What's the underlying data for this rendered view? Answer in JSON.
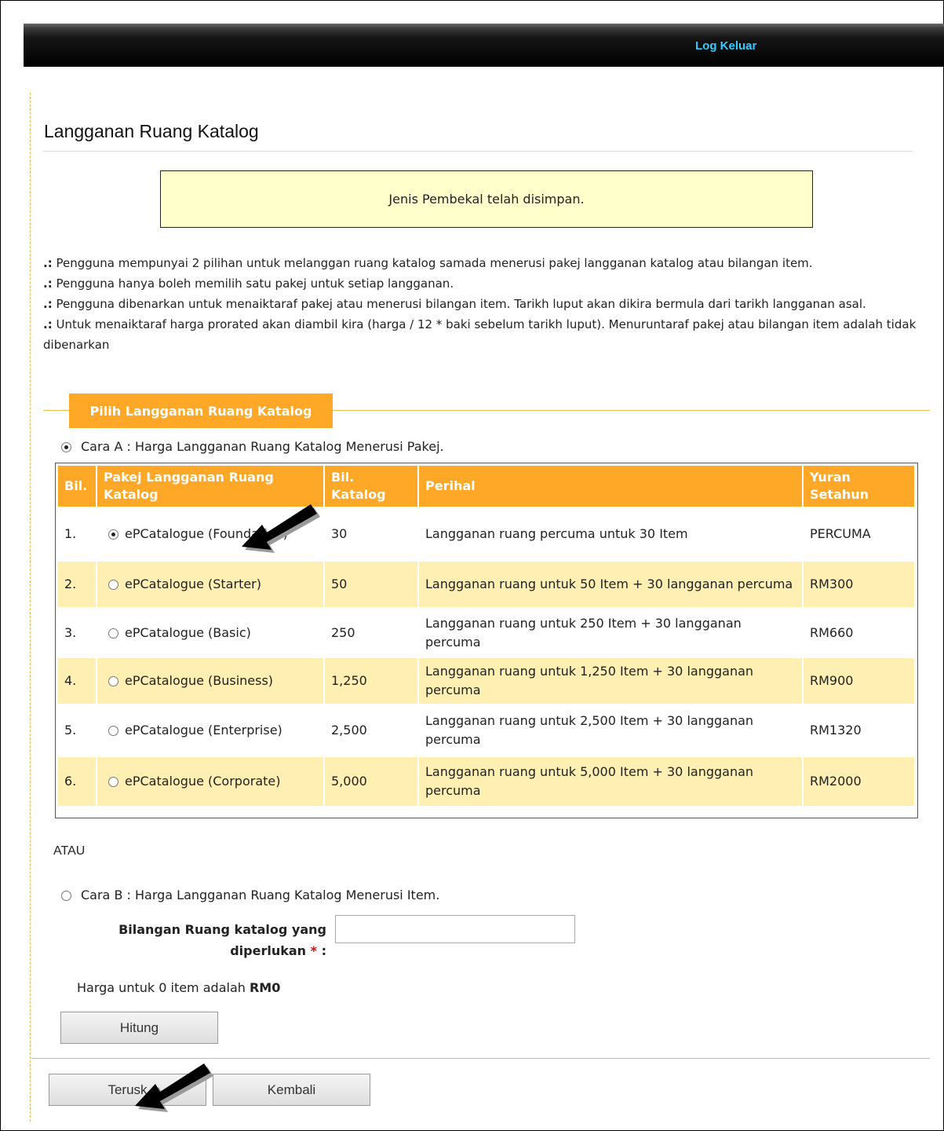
{
  "header": {
    "logout_label": "Log Keluar"
  },
  "page": {
    "title": "Langganan Ruang Katalog"
  },
  "notice": {
    "message": "Jenis Pembekal telah disimpan."
  },
  "notes": {
    "bullet": ".:",
    "items": [
      "Pengguna mempunyai 2 pilihan untuk melanggan ruang katalog samada menerusi pakej langganan katalog atau bilangan item.",
      "Pengguna hanya boleh memilih satu pakej untuk setiap langganan.",
      "Pengguna dibenarkan untuk menaiktaraf pakej atau menerusi bilangan item. Tarikh luput akan dikira bermula dari tarikh langganan asal.",
      "Untuk menaiktaraf harga prorated akan diambil kira (harga / 12 * baki sebelum tarikh luput). Menuruntaraf pakej atau bilangan item adalah tidak dibenarkan"
    ]
  },
  "section": {
    "legend": "Pilih Langganan Ruang Katalog"
  },
  "option_a": {
    "label": "Cara A : Harga Langganan Ruang Katalog Menerusi Pakej.",
    "selected": true
  },
  "table": {
    "headers": [
      "Bil.",
      "Pakej Langganan Ruang Katalog",
      "Bil. Katalog",
      "Perihal",
      "Yuran Setahun"
    ],
    "rows": [
      {
        "no": "1.",
        "package": "ePCatalogue (Foundation)",
        "count": "30",
        "desc": "Langganan ruang percuma untuk 30 Item",
        "fee": "PERCUMA",
        "selected": true
      },
      {
        "no": "2.",
        "package": "ePCatalogue (Starter)",
        "count": "50",
        "desc": "Langganan ruang untuk 50 Item + 30 langganan percuma",
        "fee": "RM300",
        "selected": false
      },
      {
        "no": "3.",
        "package": "ePCatalogue (Basic)",
        "count": "250",
        "desc": "Langganan ruang untuk 250 Item + 30 langganan percuma",
        "fee": "RM660",
        "selected": false
      },
      {
        "no": "4.",
        "package": "ePCatalogue (Business)",
        "count": "1,250",
        "desc": "Langganan ruang untuk 1,250 Item + 30 langganan percuma",
        "fee": "RM900",
        "selected": false
      },
      {
        "no": "5.",
        "package": "ePCatalogue (Enterprise)",
        "count": "2,500",
        "desc": "Langganan ruang untuk 2,500 Item + 30 langganan percuma",
        "fee": "RM1320",
        "selected": false
      },
      {
        "no": "6.",
        "package": "ePCatalogue (Corporate)",
        "count": "5,000",
        "desc": "Langganan ruang untuk 5,000 Item + 30 langganan percuma",
        "fee": "RM2000",
        "selected": false
      }
    ]
  },
  "or_label": "ATAU",
  "option_b": {
    "label": "Cara B : Harga Langganan Ruang Katalog Menerusi Item.",
    "selected": false,
    "field_label": "Bilangan Ruang katalog yang diperlukan",
    "required_mark": "*",
    "field_colon": ":",
    "field_value": "",
    "price_text_prefix": "Harga untuk 0 item adalah",
    "price_value": "RM0",
    "calculate_label": "Hitung"
  },
  "actions": {
    "continue_label": "Terusk",
    "back_label": "Kembali"
  }
}
